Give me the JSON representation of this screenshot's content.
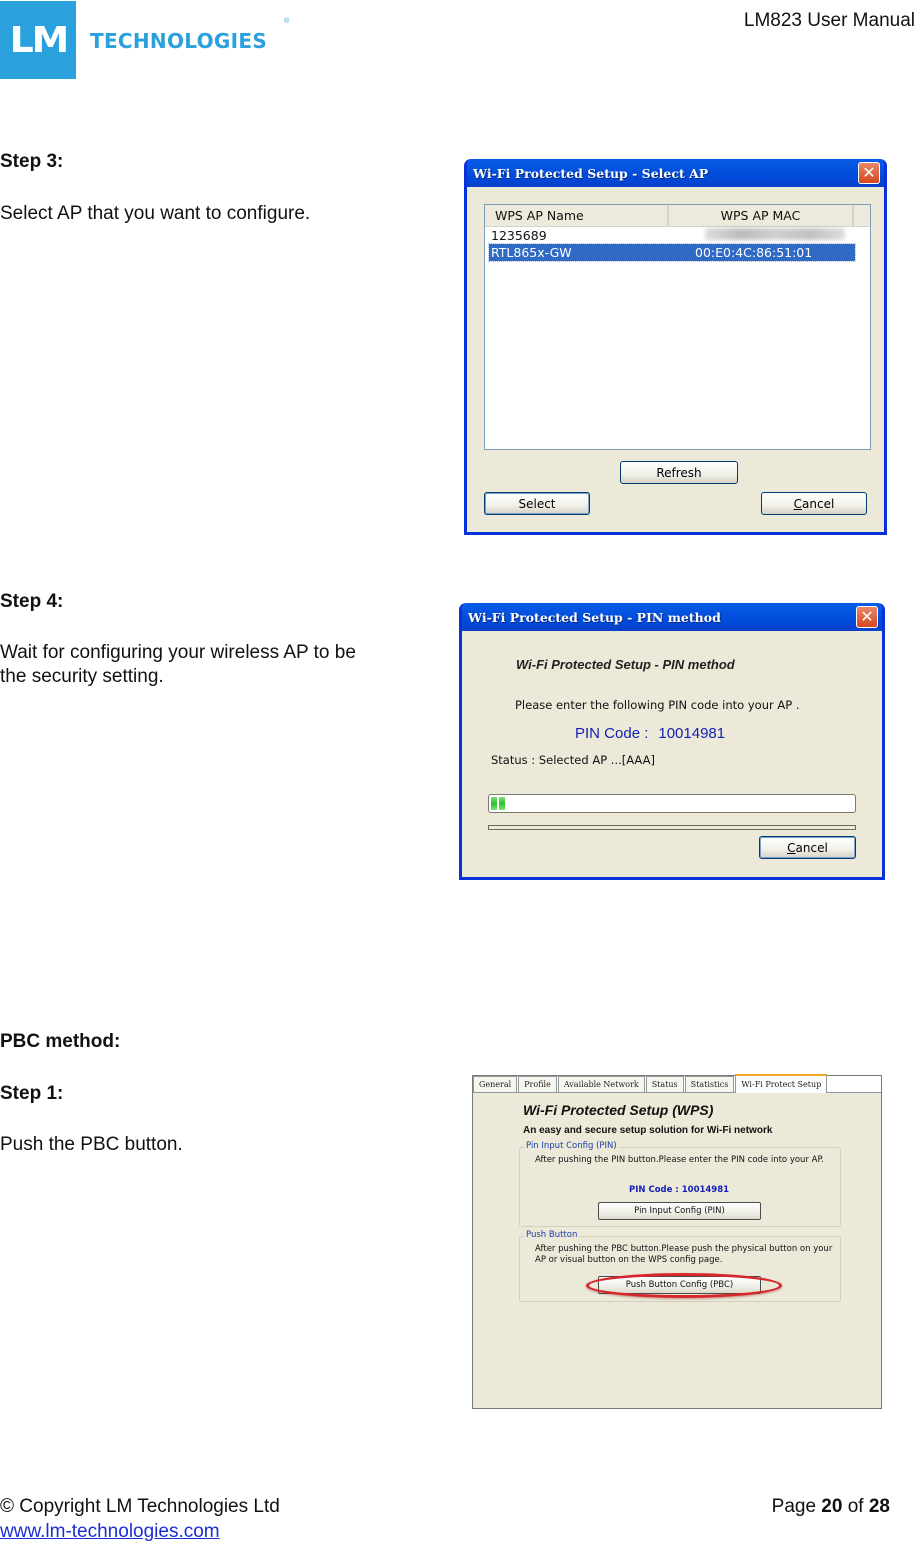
{
  "header": {
    "logo_mark": "LM",
    "logo_text": "TECHNOLOGIES",
    "logo_registered": "®",
    "document_title": "LM823 User Manual",
    "brand_color": "#2aa0dd"
  },
  "sections": {
    "step3": {
      "heading": "Step 3:",
      "text": "Select AP that you want to configure."
    },
    "step4": {
      "heading": "Step 4:",
      "text_line1": "Wait for configuring your wireless AP to be",
      "text_line2": "the security setting."
    },
    "pbc": {
      "heading": "PBC method:",
      "step_heading": "Step 1:",
      "text": "Push the PBC button."
    }
  },
  "dialog_select_ap": {
    "title": "Wi-Fi Protected Setup - Select AP",
    "close_icon": "close-x-icon",
    "columns": [
      "WPS AP Name",
      "WPS AP MAC"
    ],
    "rows": [
      {
        "name": "1235689",
        "mac": "",
        "mac_blurred": true,
        "selected": false
      },
      {
        "name": "RTL865x-GW",
        "mac": "00:E0:4C:86:51:01",
        "mac_blurred": false,
        "selected": true
      }
    ],
    "buttons": {
      "refresh": "Refresh",
      "select": "Select",
      "cancel_prefix": "C",
      "cancel_rest": "ancel"
    },
    "selection_color": "#316ac5"
  },
  "dialog_pin_method": {
    "title": "Wi-Fi Protected Setup - PIN method",
    "heading": "Wi-Fi Protected Setup - PIN method",
    "instruction": "Please enter the following PIN code into your AP .",
    "pin_label": "PIN Code :",
    "pin_value": "10014981",
    "status": "Status :  Selected AP ...[AAA]",
    "progress_percent": 5,
    "buttons": {
      "cancel_prefix": "C",
      "cancel_rest": "ancel"
    }
  },
  "dialog_wps_tab": {
    "tabs": [
      "General",
      "Profile",
      "Available Network",
      "Status",
      "Statistics",
      "Wi-Fi Protect Setup"
    ],
    "active_tab": 5,
    "title": "Wi-Fi Protected Setup (WPS)",
    "subtitle": "An easy and secure setup solution for Wi-Fi network",
    "pin_group": {
      "legend": "Pin Input Config (PIN)",
      "text": "After pushing the PIN button.Please enter the PIN code into your AP.",
      "pin_label": "PIN Code :",
      "pin_value": "10014981",
      "button": "Pin Input Config (PIN)"
    },
    "push_group": {
      "legend": "Push Button",
      "text": "After pushing the PBC button.Please push the physical button on your AP or visual button on the WPS config page.",
      "button": "Push Button Config (PBC)"
    },
    "highlight_color": "#d7262a"
  },
  "footer": {
    "copyright": "© Copyright LM Technologies Ltd",
    "website": "www.lm-technologies.com",
    "page_prefix": "Page",
    "page_current": "20",
    "page_of": "of",
    "page_total": "28"
  }
}
